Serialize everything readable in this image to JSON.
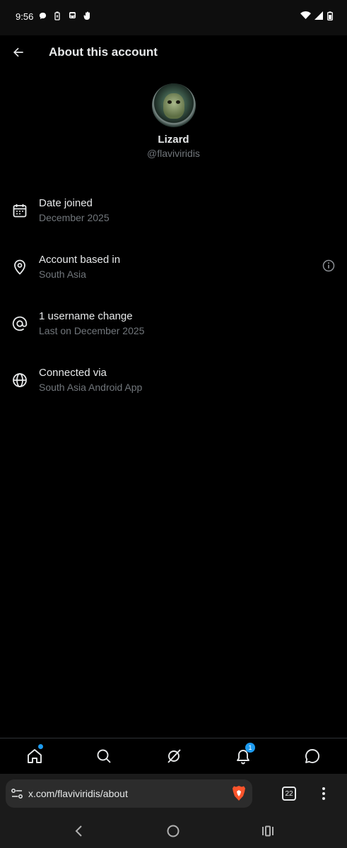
{
  "status_bar": {
    "time": "9:56",
    "left_icons": [
      "chat-bubble-icon",
      "battery-saver-icon",
      "bus-icon",
      "hand-icon"
    ],
    "right_icons": [
      "wifi-icon",
      "signal-icon",
      "battery-icon"
    ]
  },
  "header": {
    "title": "About this account",
    "back_icon": "arrow-left-icon"
  },
  "profile": {
    "display_name": "Lizard",
    "handle": "@flaviviridis"
  },
  "info": [
    {
      "icon": "calendar-icon",
      "label": "Date joined",
      "value": "December 2025"
    },
    {
      "icon": "location-pin-icon",
      "label": "Account based in",
      "value": "South Asia",
      "info_icon": "info-icon"
    },
    {
      "icon": "at-sign-icon",
      "label": "1 username change",
      "value": "Last on December 2025"
    },
    {
      "icon": "globe-icon",
      "label": "Connected via",
      "value": "South Asia Android App"
    }
  ],
  "tab_bar": {
    "items": [
      "home-icon",
      "search-icon",
      "grok-icon",
      "bell-icon",
      "message-icon"
    ],
    "notifications_badge": "1"
  },
  "browser": {
    "url": "x.com/flaviviridis/about",
    "tab_count": "22"
  },
  "nav_bar": {
    "items": [
      "back-icon",
      "home-circle-icon",
      "recents-icon"
    ]
  },
  "colors": {
    "background": "#000000",
    "primary_text": "#e7e9ea",
    "secondary_text": "#71767b",
    "accent": "#1d9bf0"
  }
}
